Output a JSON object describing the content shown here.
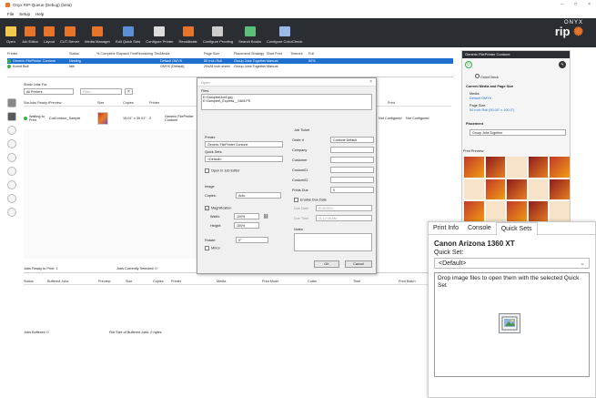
{
  "window": {
    "title": "Onyx RIP-Queue (Debug) (beta)",
    "controls": [
      "–",
      "□",
      "×"
    ]
  },
  "menu": [
    "File",
    "Setup",
    "Help"
  ],
  "toolbar": [
    {
      "label": "Open",
      "color": "#f2c94c"
    },
    {
      "label": "Job Editor",
      "color": "#e8742a"
    },
    {
      "label": "Layout",
      "color": "#e8742a"
    },
    {
      "label": "CUT-Server",
      "color": "#e8742a"
    },
    {
      "label": "Media Manager",
      "color": "#e8742a"
    },
    {
      "label": "Edit Quick Sets",
      "color": "#5b8ed6"
    },
    {
      "label": "Configure Printer",
      "color": "#dddddd"
    },
    {
      "label": "Recalibrate",
      "color": "#e8742a"
    },
    {
      "label": "Configure Proofing",
      "color": "#cccccc"
    },
    {
      "label": "Search Books",
      "color": "#5bbf7a"
    },
    {
      "label": "Configure ColorCheck",
      "color": "#9ab8e8"
    }
  ],
  "brand": {
    "top": "ONYX",
    "main": "rip"
  },
  "printers": {
    "headers": [
      "Printer",
      "Status",
      "% Complete",
      "Elapsed Time",
      "Remaining Time",
      "Media",
      "Page Size",
      "Placement Strategy",
      "Start Print",
      "Timeout",
      "Full"
    ],
    "rows": [
      {
        "cells": [
          "Generic FilePrinter Contone",
          "Nesting",
          "",
          "",
          "",
          "Default OMYK",
          "50 Inch Roll",
          "Group Jobs Together",
          "Manual",
          "",
          "50%"
        ]
      },
      {
        "cells": [
          "Kornit Bolt",
          "Idle",
          "",
          "",
          "",
          "OMYK [Default]",
          "20x28 inch sheet",
          "Group Jobs Together",
          "Manual",
          "",
          ""
        ]
      }
    ]
  },
  "jobs": {
    "show_label": "Show Jobs For:",
    "printer_filter": "All Printers",
    "filter_placeholder": "Filter...",
    "headers": [
      "Status",
      "Jobs Ready to Print",
      "Preview",
      "Size",
      "Copies",
      "Printer",
      "",
      "",
      "",
      "",
      "",
      "",
      "Ink Use (in...",
      "Total Ink",
      "Print"
    ],
    "rows": [
      {
        "status": "Waiting to Print",
        "name": "CutContour_Sample",
        "size": "15.01\" x 30.01\"",
        "copies": "2",
        "printer": "Generic FilePrinter Contone",
        "ink_use": "Not Configured",
        "total_ink": "Not Configured",
        "extra": "H"
      }
    ],
    "ready_count": "Jobs Ready to Print: 1",
    "selected_count": "Jobs Currently Selected: 0"
  },
  "buffered": {
    "headers": [
      "Status",
      "Buffered Jobs",
      "Preview",
      "Size",
      "Copies",
      "Printer",
      "Media",
      "Print Mode",
      "Cutter",
      "Time",
      "Print Batch"
    ],
    "count": "Jobs Buffered: 0",
    "filesize": "File Size of Buffered Jobs: 0 bytes"
  },
  "dialog": {
    "title": "Open",
    "files_label": "Files:",
    "files": [
      "E:\\Samples\\1cell.jpg",
      "E:\\Samples\\_Express__0464.PS"
    ],
    "printer_label": "Printer:",
    "printer": "Generic FilePrinter Contone",
    "quickset_label": "Quick Sets:",
    "quickset": "<Default>",
    "open_in_editor": "Open in Job Editor",
    "image_label": "Image",
    "copies_label": "Copies:",
    "copies": "Auto",
    "magnification": "Magnification",
    "width_label": "Width:",
    "width": "100%",
    "height_label": "Height:",
    "height": "100%",
    "rotate_label": "Rotate:",
    "rotate": "0°",
    "mirror": "Mirror",
    "jobticket_label": "Job Ticket",
    "order_label": "Order #",
    "order": "Contone Default",
    "company_label": "Company",
    "customer_label": "Customer",
    "custom01_label": "Custom01",
    "custom02_label": "Custom02",
    "prints_due_label": "Prints Due",
    "prints_due": "0",
    "enable_due": "Enable Due Date",
    "due_date_label": "Due Date",
    "due_date": "6/15/2021",
    "due_time_label": "Due Time",
    "due_time": "11:12:05 AM",
    "notes_label": "Notes",
    "ok": "OK",
    "cancel": "Cancel"
  },
  "right_panel": {
    "title": "Generic FilePrinter Contone",
    "colorcheck": "ColorCheck",
    "media_section": "Current Media and Page Size",
    "media_label": "Media:",
    "media": "Default OMYK",
    "pagesize_label": "Page Size:",
    "pagesize": "50 Inch Roll (50.00\" x 100.0\")",
    "placement_label": "Placement",
    "placement": "Group Jobs Together",
    "preview_label": "Print Preview"
  },
  "quickset_panel": {
    "tabs": [
      "Print Info",
      "Console",
      "Quick Sets"
    ],
    "active_tab": 2,
    "printer_name": "Canon Arizona 1360 XT",
    "quickset_label": "Quick Set:",
    "quickset": "<Default>",
    "drop_text": "Drop image files to open them with the selected Quick Set"
  }
}
